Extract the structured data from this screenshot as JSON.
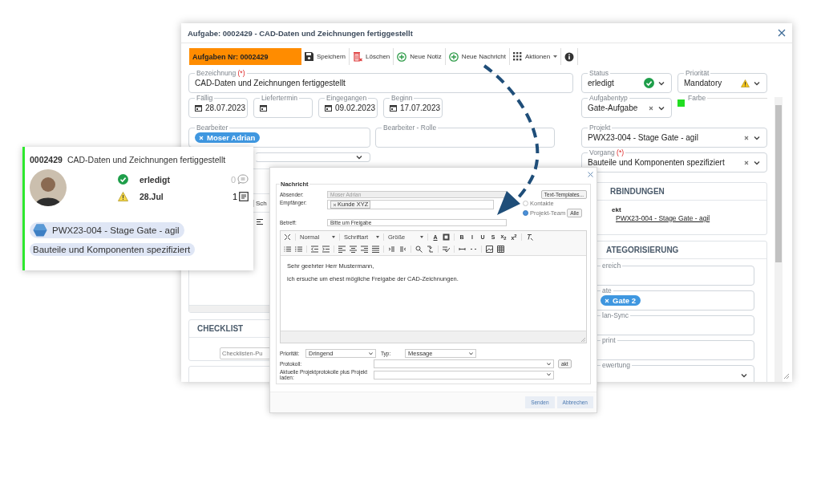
{
  "task_window": {
    "title": "Aufgabe: 0002429 - CAD-Daten und Zeichnungen fertiggestellt",
    "toolbar": {
      "task_number": "Aufgaben Nr: 0002429",
      "buttons": [
        {
          "kind": "save",
          "label": "Speichern"
        },
        {
          "kind": "delete",
          "label": "Löschen"
        },
        {
          "kind": "add",
          "label": "Neue Notiz"
        },
        {
          "kind": "add",
          "label": "Neue Nachricht"
        },
        {
          "kind": "menu",
          "label": "Aktionen"
        },
        {
          "kind": "info"
        }
      ]
    },
    "bezeichnung": {
      "label": "Bezeichnung",
      "required": "(*)",
      "value": "CAD-Daten und Zeichnungen fertiggestellt"
    },
    "dates": [
      {
        "label": "Fällig",
        "value": "28.07.2023"
      },
      {
        "label": "Liefertermin"
      },
      {
        "label": "Eingegangen",
        "value": "09.02.2023"
      },
      {
        "label": "Beginn",
        "value": "17.07.2023"
      }
    ],
    "bearbeiter": {
      "label": "Bearbeiter",
      "chips": [
        "Moser Adrian"
      ]
    },
    "bearbeiter_rolle": {
      "label": "Bearbeiter - Rolle"
    },
    "section_tab_label": "Sch",
    "checklist": {
      "title": "CHECKLIST",
      "placeholder": "Checklisten-Pu"
    },
    "status": {
      "label": "Status",
      "value": "erledigt"
    },
    "prioritaet": {
      "label": "Priorität",
      "value": "Mandatory"
    },
    "aufgabentyp": {
      "label": "Aufgabentyp",
      "value": "Gate-Aufgabe"
    },
    "farbe": {
      "label": "Farbe",
      "color": "#22dd22"
    },
    "projekt": {
      "label": "Projekt",
      "value": "PWX23-004 - Stage Gate - agil"
    },
    "vorgang": {
      "label": "Vorgang",
      "required": "(*)",
      "value": "Bauteile und Komponenten spezifiziert"
    },
    "verbindungen": {
      "title": "RBINDUNGEN",
      "label": "ekt",
      "link": "PWX23-004 - Stage Gate - agil"
    },
    "kategorisierung": {
      "title": "ATEGORISIERUNG",
      "fields": [
        {
          "kind": "text",
          "label": "ereich"
        },
        {
          "kind": "chips",
          "label": "ate",
          "chips": [
            "Gate 2"
          ]
        },
        {
          "kind": "text",
          "label": "lan-Sync"
        },
        {
          "kind": "text",
          "label": "print"
        },
        {
          "kind": "select",
          "label": "ewertung"
        }
      ]
    }
  },
  "task_card": {
    "number": "0002429",
    "title": "CAD-Daten und Zeichnungen fertiggestellt",
    "status": "erledigt",
    "due": "28.Jul",
    "comments": "0",
    "notes": "1",
    "project": "PWX23-004 - Stage Gate - agil",
    "process": "Bauteile und Komponenten spezifiziert"
  },
  "message_dialog": {
    "section": "Nachricht",
    "absender": {
      "label": "Absender:",
      "value": "Moser Adrian",
      "disabled": true
    },
    "templates_button": "Text-Templates...",
    "empfaenger": {
      "label": "Empfänger:",
      "chips": [
        "Kunde XYZ"
      ]
    },
    "recipient_options": [
      {
        "label": "Kontakte",
        "selected": false
      },
      {
        "label": "Projekt-Team",
        "selected": true
      }
    ],
    "all_button": "Alle",
    "betreff": {
      "label": "Betreff:",
      "value": "Bitte um Freigabe"
    },
    "editor": {
      "format": "Normal",
      "font": "Schriftart",
      "size": "Größe",
      "color_button": "A",
      "style_buttons": [
        "B",
        "I",
        "U",
        "S",
        "x$_{2}$",
        "x$^{2}$"
      ],
      "paragraphs": [
        "Sehr geehrter Herr Mustermann,",
        "ich ersuche um ehest mögliche Freigabe der CAD-Zeichnungen."
      ]
    },
    "prioritaet": {
      "label": "Priorität:",
      "value": "Dringend"
    },
    "typ": {
      "label": "Typ:",
      "value": "Message"
    },
    "protokoll": {
      "label": "Protokoll:"
    },
    "akt_button": "akt",
    "laden": {
      "label": "Aktuelle Projektprotokolle plus Projekt laden:"
    },
    "buttons": [
      "Senden",
      "Abbrechen"
    ]
  }
}
